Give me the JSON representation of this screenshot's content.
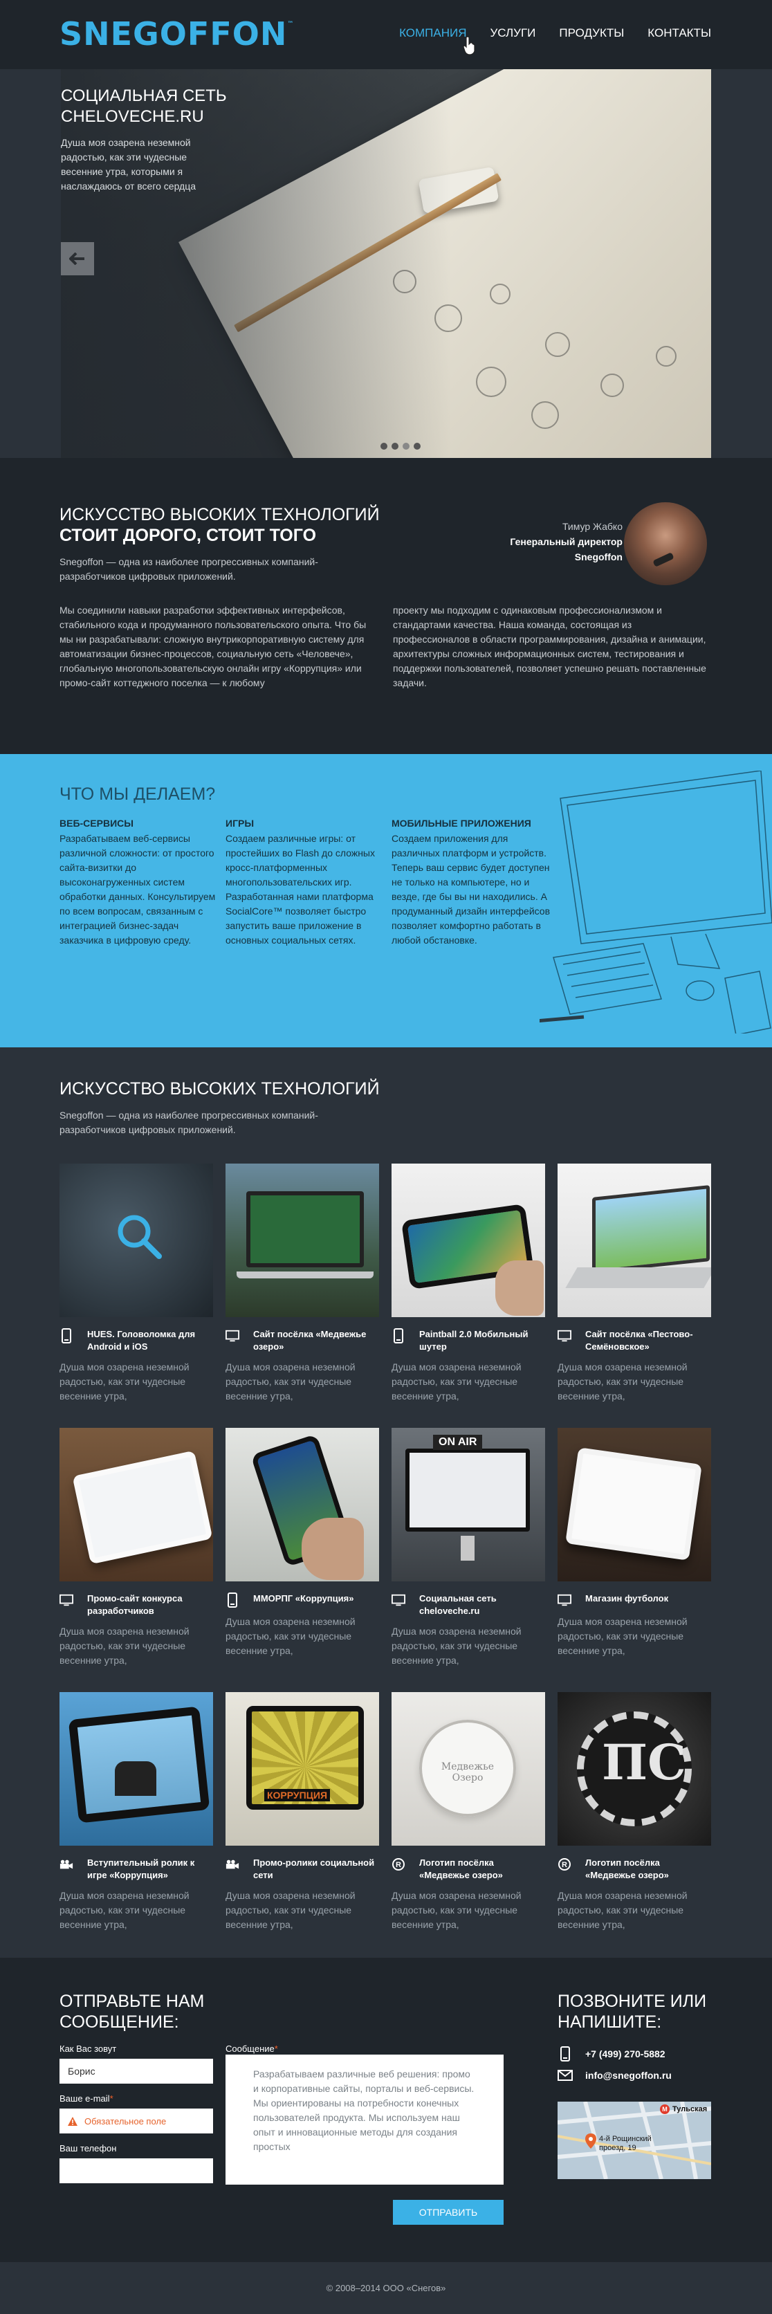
{
  "header": {
    "logo": "SNEGOFFON",
    "logo_tm": "™",
    "nav": [
      "КОМПАНИЯ",
      "УСЛУГИ",
      "ПРОДУКТЫ",
      "КОНТАКТЫ"
    ]
  },
  "hero": {
    "title": "СОЦИАЛЬНАЯ СЕТЬ CHELOVECHE.RU",
    "text": "Душа моя озарена неземной радостью, как эти чудесные весенние утра, которыми я наслаждаюсь от всего сердца",
    "slides_count": 4,
    "active_slide": 3
  },
  "about": {
    "title": "ИСКУССТВО ВЫСОКИХ ТЕХНОЛОГИЙ",
    "subtitle": "СТОИТ ДОРОГО, СТОИТ ТОГО",
    "intro": "Snegoffon — одна из наиболее прогрессивных компаний-разработчиков цифровых приложений.",
    "col1": "Мы соединили навыки разработки эффективных интерфейсов, стабильного кода и продуманного пользовательского опыта. Что бы мы ни разрабатывали: сложную внутрикорпоративную систему для автоматизации бизнес-процессов, социальную сеть «Человече», глобальную многопользовательскую онлайн игру «Коррупция» или промо-сайт коттеджного поселка — к любому",
    "col2": "проекту мы подходим с одинаковым профессионализмом и стандартами качества. Наша команда, состоящая из профессионалов в области программирования, дизайна и анимации, архитектуры сложных информационных систем, тестирования и поддержки пользователей, позволяет успешно решать поставленные задачи.",
    "person_name": "Тимур Жабко",
    "person_role": "Генеральный директор",
    "person_company": "Snegoffon"
  },
  "what": {
    "title": "ЧТО МЫ ДЕЛАЕМ?",
    "cols": [
      {
        "title": "ВЕБ-СЕРВИСЫ",
        "text": "Разрабатываем веб-сервисы различной сложности: от простого сайта-визитки до высоконагруженных систем обработки данных. Консультируем по всем вопросам, связанным с интеграцией бизнес-задач заказчика в цифровую среду."
      },
      {
        "title": "ИГРЫ",
        "text": "Создаем различные игры: от простейших во Flash до сложных кросс-платформенных многопользовательских игр. Разработанная нами платформа SocialCore™ позволяет быстро запустить ваше приложение в основных социальных сетях."
      },
      {
        "title": "МОБИЛЬНЫЕ ПРИЛОЖЕНИЯ",
        "text": "Создаем приложения для различных платформ и устройств. Теперь ваш сервис будет доступен не только на компьютере, но и везде, где бы вы ни находились. А продуманный дизайн интерфейсов позволяет комфортно работать в любой обстановке."
      }
    ]
  },
  "work": {
    "title": "ИСКУССТВО ВЫСОКИХ ТЕХНОЛОГИЙ",
    "intro": "Snegoffon — одна из наиболее прогрессивных компаний-разработчиков цифровых приложений.",
    "items": [
      {
        "title": "HUES. Головоломка для Android и iOS",
        "icon": "phone-icon",
        "desc": "Душа моя озарена неземной радостью, как эти чудесные весенние утра,"
      },
      {
        "title": "Сайт посёлка «Медвежье озеро»",
        "icon": "monitor-icon",
        "desc": "Душа моя озарена неземной радостью, как эти чудесные весенние утра,"
      },
      {
        "title": "Paintball 2.0 Мобильный шутер",
        "icon": "phone-icon",
        "desc": "Душа моя озарена неземной радостью, как эти чудесные весенние утра,"
      },
      {
        "title": "Сайт посёлка «Пестово-Семёновское»",
        "icon": "monitor-icon",
        "desc": "Душа моя озарена неземной радостью, как эти чудесные весенние утра,"
      },
      {
        "title": "Промо-сайт конкурса разработчиков",
        "icon": "monitor-icon",
        "desc": "Душа моя озарена неземной радостью, как эти чудесные весенние утра,"
      },
      {
        "title": "ММОРПГ «Коррупция»",
        "icon": "phone-icon",
        "desc": "Душа моя озарена неземной радостью, как эти чудесные весенние утра,"
      },
      {
        "title": "Социальная сеть cheloveche.ru",
        "icon": "monitor-icon",
        "desc": "Душа моя озарена неземной радостью, как эти чудесные весенние утра,"
      },
      {
        "title": "Магазин футболок",
        "icon": "monitor-icon",
        "desc": "Душа моя озарена неземной радостью, как эти чудесные весенние утра,"
      },
      {
        "title": "Вступительный ролик к игре «Коррупция»",
        "icon": "camera-icon",
        "desc": "Душа моя озарена неземной радостью, как эти чудесные весенние утра,"
      },
      {
        "title": "Промо-ролики социальной сети",
        "icon": "camera-icon",
        "desc": "Душа моя озарена неземной радостью, как эти чудесные весенние утра,"
      },
      {
        "title": "Логотип посёлка «Медвежье озеро»",
        "icon": "registered-icon",
        "desc": "Душа моя озарена неземной радостью, как эти чудесные весенние утра,"
      },
      {
        "title": "Логотип посёлка «Медвежье озеро»",
        "icon": "registered-icon",
        "desc": "Душа моя озарена неземной радостью, как эти чудесные весенние утра,"
      }
    ],
    "thumb_texts": {
      "tv": "ON AIR",
      "game": "КОРРУПЦИЯ",
      "seal": "Медвежье Озеро"
    }
  },
  "contact": {
    "title": "ОТПРАВЬТЕ НАМ СООБЩЕНИЕ:",
    "title_right": "ПОЗВОНИТЕ ИЛИ НАПИШИТЕ:",
    "name_label": "Как Вас зовут",
    "name_value": "Борис",
    "email_label": "Ваше e-mail",
    "email_error": "Обязательное поле",
    "phone_label": "Ваш телефон",
    "message_label": "Сообщение",
    "message_value": "Разрабатываем различные веб решения: промо и корпоративные сайты, порталы и веб-сервисы. Мы ориентированы на потребности конечных пользователей продукта. Мы используем наш опыт и инновационные методы для создания простых",
    "submit": "ОТПРАВИТЬ",
    "phone": "+7 (499) 270-5882",
    "email": "info@snegoffon.ru",
    "map_metro": "Тульская",
    "map_address": "4-й Рощинский проезд, 19"
  },
  "footer": {
    "copyright": "© 2008–2014 ООО «Снегов»"
  },
  "colors": {
    "accent": "#3bb1e6",
    "dark": "#1f252b",
    "mid": "#2b323a",
    "error": "#e6632c"
  }
}
